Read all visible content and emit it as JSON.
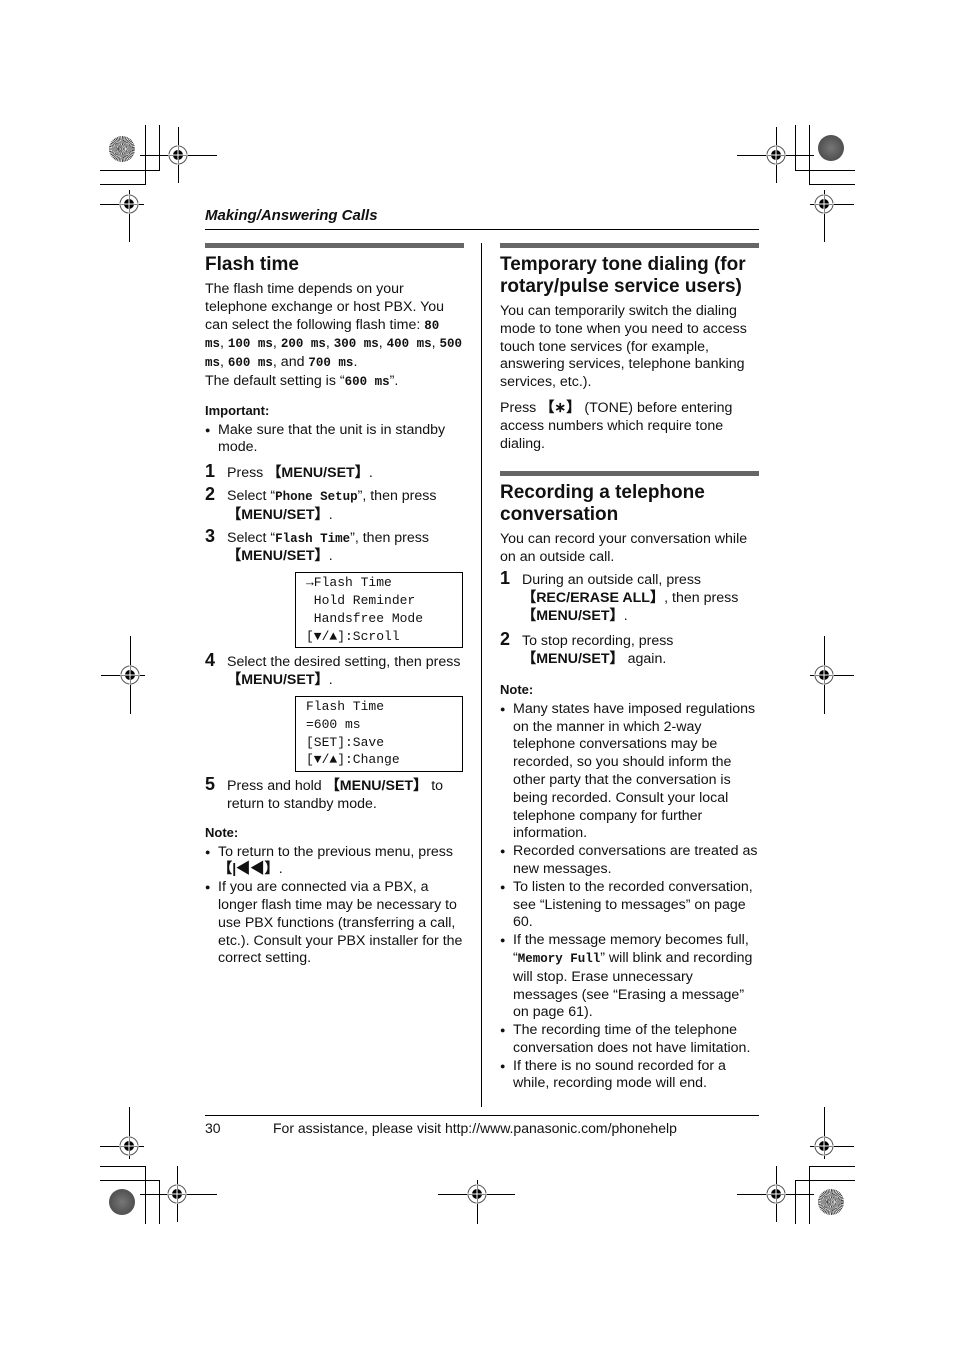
{
  "header": {
    "running_title": "Making/Answering Calls"
  },
  "left_column": {
    "title": "Flash time",
    "intro_parts": [
      "The flash time depends on your telephone exchange or host PBX. You can select the following flash time: ",
      "80 ms",
      ", ",
      "100 ms",
      ", ",
      "200 ms",
      ", ",
      "300 ms",
      ", ",
      "400 ms",
      ", ",
      "500 ms",
      ", ",
      "600 ms",
      ", and ",
      "700 ms",
      "."
    ],
    "default_prefix": "The default setting is “",
    "default_value": "600 ms",
    "default_suffix": "”.",
    "important_label": "Important:",
    "important_bullets": [
      "Make sure that the unit is in standby mode."
    ],
    "steps": [
      {
        "num": "1",
        "pre": "Press ",
        "key": "【MENU/SET】",
        "post": "."
      },
      {
        "num": "2",
        "pre": "Select “",
        "code": "Phone Setup",
        "mid": "”, then press ",
        "key": "【MENU/SET】",
        "post": "."
      },
      {
        "num": "3",
        "pre": "Select “",
        "code": "Flash Time",
        "mid": "”, then press ",
        "key": "【MENU/SET】",
        "post": "."
      },
      {
        "num": "4",
        "pre": "Select the desired setting, then press ",
        "key": "【MENU/SET】",
        "post": "."
      },
      {
        "num": "5",
        "pre": "Press and hold ",
        "key": "【MENU/SET】",
        "post": " to return to standby mode."
      }
    ],
    "display1": [
      "→Flash Time",
      " Hold Reminder",
      " Handsfree Mode",
      "[▼/▲]:Scroll"
    ],
    "display2": [
      "Flash Time",
      "=600 ms",
      "[SET]:Save",
      "[▼/▲]:Change"
    ],
    "note_label": "Note:",
    "note_bullet1_pre": "To return to the previous menu, press ",
    "note_bullet1_key": "【|◀◀】",
    "note_bullet1_post": ".",
    "note_bullet2": "If you are connected via a PBX, a longer flash time may be necessary to use PBX functions (transferring a call, etc.). Consult your PBX installer for the correct setting."
  },
  "right_column": {
    "section1": {
      "title": "Temporary tone dialing (for rotary/pulse service users)",
      "para1": "You can temporarily switch the dialing mode to tone when you need to access touch tone services (for example, answering services, telephone banking services, etc.).",
      "para2_pre": "Press ",
      "para2_key": "【∗】",
      "para2_post": " (TONE) before entering access numbers which require tone dialing."
    },
    "section2": {
      "title": "Recording a telephone conversation",
      "intro": "You can record your conversation while on an outside call.",
      "step1": {
        "num": "1",
        "pre": "During an outside call, press ",
        "key1": "【REC/ERASE ALL】",
        "mid": ", then press ",
        "key2": "【MENU/SET】",
        "post": "."
      },
      "step2": {
        "num": "2",
        "pre": "To stop recording, press ",
        "key": "【MENU/SET】",
        "post": " again."
      },
      "note_label": "Note:",
      "bullets": [
        "Many states have imposed regulations on the manner in which 2-way telephone conversations may be recorded, so you should inform the other party that the conversation is being recorded. Consult your local telephone company for further information.",
        "Recorded conversations are treated as new messages.",
        "To listen to the recorded conversation, see “Listening to messages” on page 60."
      ],
      "bullet4_pre": "If the message memory becomes full, “",
      "bullet4_code": "Memory Full",
      "bullet4_post": "” will blink and recording will stop. Erase unnecessary messages (see “Erasing a message” on page 61).",
      "bullets_end": [
        "The recording time of the telephone conversation does not have limitation.",
        "If there is no sound recorded for a while, recording mode will end."
      ]
    }
  },
  "footer": {
    "page_number": "30",
    "assistance_text": "For assistance, please visit http://www.panasonic.com/phonehelp"
  }
}
